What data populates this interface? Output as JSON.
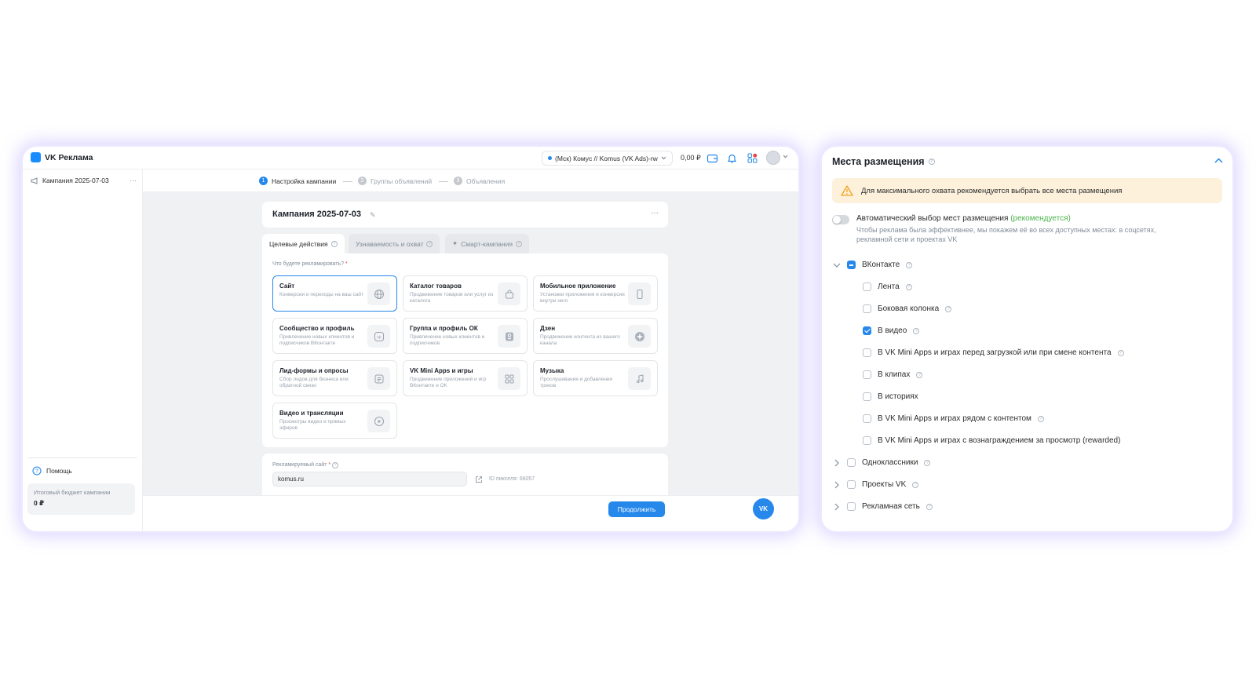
{
  "app": {
    "logo": "VK Реклама",
    "account": "(Мск) Комус // Komus (VK Ads)-rw",
    "balance": "0,00 ₽",
    "sidebar": {
      "campaign": "Кампания 2025-07-03",
      "help": "Помощь",
      "budget_label": "Итоговый бюджет кампании",
      "budget_value": "0 ₽"
    },
    "steps": [
      {
        "num": "1",
        "label": "Настройка кампании"
      },
      {
        "num": "2",
        "label": "Группы объявлений"
      },
      {
        "num": "3",
        "label": "Объявления"
      }
    ],
    "campaign_title": "Кампания 2025-07-03",
    "tabs": [
      {
        "label": "Целевые действия"
      },
      {
        "label": "Узнаваемость и охват"
      },
      {
        "label": "Смарт-кампания"
      }
    ],
    "objective_question": "Что будете рекламировать?",
    "objective_required": "*",
    "objectives": [
      {
        "title": "Сайт",
        "desc": "Конверсии и переходы на ваш сайт",
        "icon": "globe-icon"
      },
      {
        "title": "Каталог товаров",
        "desc": "Продвижение товаров или услуг из каталога",
        "icon": "bag-icon"
      },
      {
        "title": "Мобильное приложение",
        "desc": "Установки приложения и конверсии внутри него",
        "icon": "phone-icon"
      },
      {
        "title": "Сообщество и профиль",
        "desc": "Привлечение новых клиентов и подписчиков ВКонтакте",
        "icon": "vk-icon"
      },
      {
        "title": "Группа и профиль ОК",
        "desc": "Привлечение новых клиентов и подписчиков",
        "icon": "ok-icon"
      },
      {
        "title": "Дзен",
        "desc": "Продвижение контента из вашего канала",
        "icon": "dzen-icon"
      },
      {
        "title": "Лид-формы и опросы",
        "desc": "Сбор лидов для бизнеса или обратной связи",
        "icon": "form-icon"
      },
      {
        "title": "VK Mini Apps и игры",
        "desc": "Продвижение приложений и игр ВКонтакте и ОК",
        "icon": "apps-icon"
      },
      {
        "title": "Музыка",
        "desc": "Прослушивания и добавления треков",
        "icon": "music-icon"
      },
      {
        "title": "Видео и трансляции",
        "desc": "Просмотры видео и прямых эфиров",
        "icon": "play-icon"
      }
    ],
    "site_label": "Рекламируемый сайт",
    "site_required": "*",
    "site_value": "komus.ru",
    "pixel": "ID пикселя: 66057",
    "continue": "Продолжить",
    "fab": "VK"
  },
  "placements": {
    "title": "Места размещения",
    "warning": "Для максимального охвата рекомендуется выбрать все места размещения",
    "auto_title": "Автоматический выбор мест размещения",
    "auto_rec": "(рекомендуется)",
    "auto_desc": "Чтобы реклама была эффективнее, мы покажем её во всех доступных местах: в соцсетях, рекламной сети и проектах VK",
    "auto_enabled": false,
    "groups": [
      {
        "label": "ВКонтакте",
        "state": "partial",
        "expanded": true
      },
      {
        "label": "Одноклассники",
        "state": "unchecked",
        "expanded": false
      },
      {
        "label": "Проекты VK",
        "state": "unchecked",
        "expanded": false
      },
      {
        "label": "Рекламная сеть",
        "state": "unchecked",
        "expanded": false
      }
    ],
    "vk_items": [
      {
        "label": "Лента",
        "checked": false
      },
      {
        "label": "Боковая колонка",
        "checked": false
      },
      {
        "label": "В видео",
        "checked": true
      },
      {
        "label": "В VK Mini Apps и играх перед загрузкой или при смене контента",
        "checked": false
      },
      {
        "label": "В клипах",
        "checked": false
      },
      {
        "label": "В историях",
        "checked": false
      },
      {
        "label": "В VK Mini Apps и играх рядом с контентом",
        "checked": false
      },
      {
        "label": "В VK Mini Apps и играх с вознаграждением за просмотр (rewarded)",
        "checked": false
      }
    ]
  },
  "colors": {
    "accent": "#2688eb",
    "recommend": "#4bb34b",
    "warning_bg": "#fdf1dc",
    "warning_icon": "#f4a21b"
  }
}
